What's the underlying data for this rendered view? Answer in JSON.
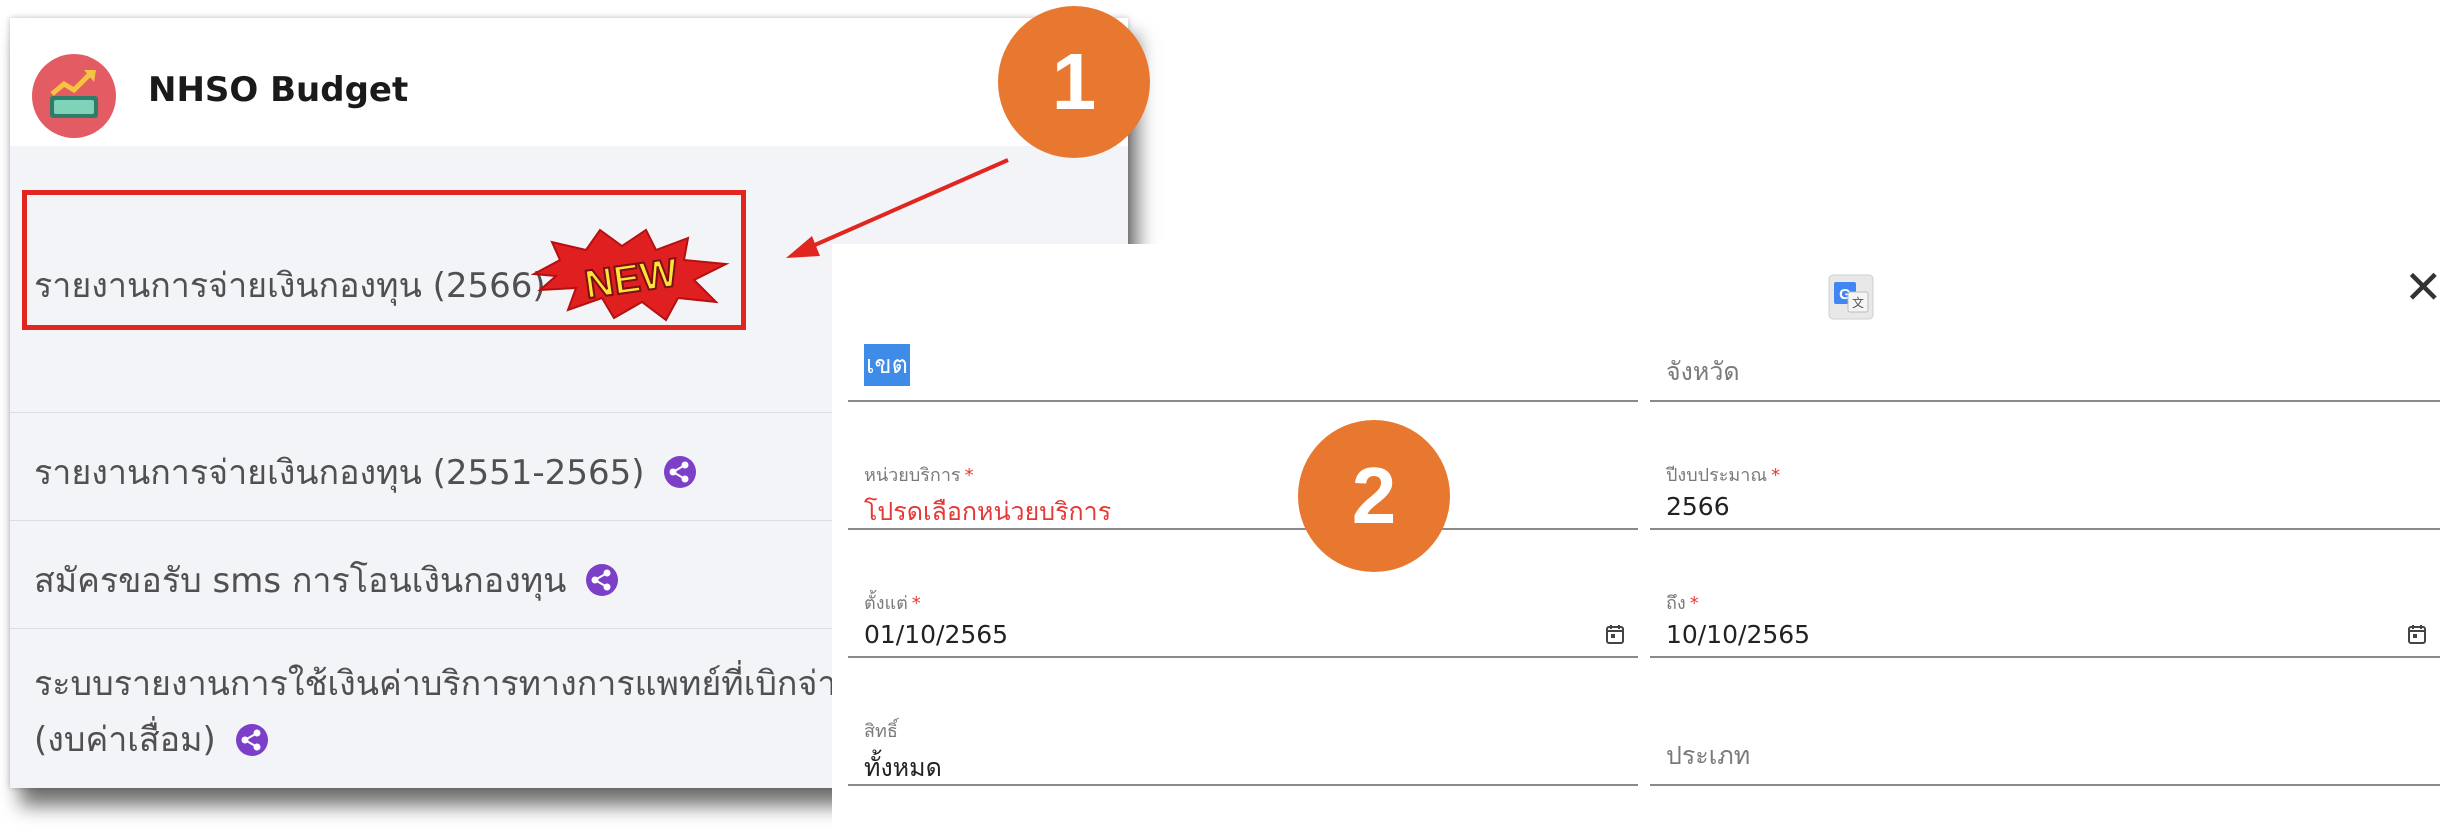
{
  "app": {
    "title": "NHSO Budget",
    "logo_icon": "money-graph-icon",
    "brand_color": "#e35b63"
  },
  "menu": {
    "items": [
      {
        "label": "รายงานการจ่ายเงินกองทุน (2566)",
        "badge": "NEW",
        "highlighted": true
      },
      {
        "label": "รายงานการจ่ายเงินกองทุน (2551-2565)",
        "icon": "share-icon"
      },
      {
        "label": "สมัครขอรับ sms การโอนเงินกองทุน",
        "icon": "share-icon"
      },
      {
        "label_line1": "ระบบรายงานการใช้เงินค่าบริการทางการแพทย์ที่เบิกจ่ายใ",
        "label_line2": "(งบค่าเสื่อม)",
        "icon": "share-icon"
      }
    ],
    "highlight_color": "#e0261f"
  },
  "steps": {
    "one": "1",
    "two": "2",
    "color": "#e8782f"
  },
  "form": {
    "translate_icon": "google-translate-icon",
    "close_label": "✕",
    "fields": {
      "zone": {
        "placeholder": "เขต",
        "selected": true
      },
      "province": {
        "placeholder": "จังหวัด"
      },
      "service_unit": {
        "label": "หน่วยบริการ",
        "required": "*",
        "value": "โปรดเลือกหน่วยบริการ",
        "error": true
      },
      "fiscal_year": {
        "label": "ปีงบประมาณ",
        "required": "*",
        "value": "2566"
      },
      "from_date": {
        "label": "ตั้งแต่",
        "required": "*",
        "value": "01/10/2565",
        "icon": "calendar-icon"
      },
      "to_date": {
        "label": "ถึง",
        "required": "*",
        "value": "10/10/2565",
        "icon": "calendar-icon"
      },
      "right": {
        "label": "สิทธิ์",
        "value": "ทั้งหมด"
      },
      "type": {
        "placeholder": "ประเภท"
      }
    },
    "error_color": "#e53935",
    "accent_color": "#3f8be8"
  }
}
